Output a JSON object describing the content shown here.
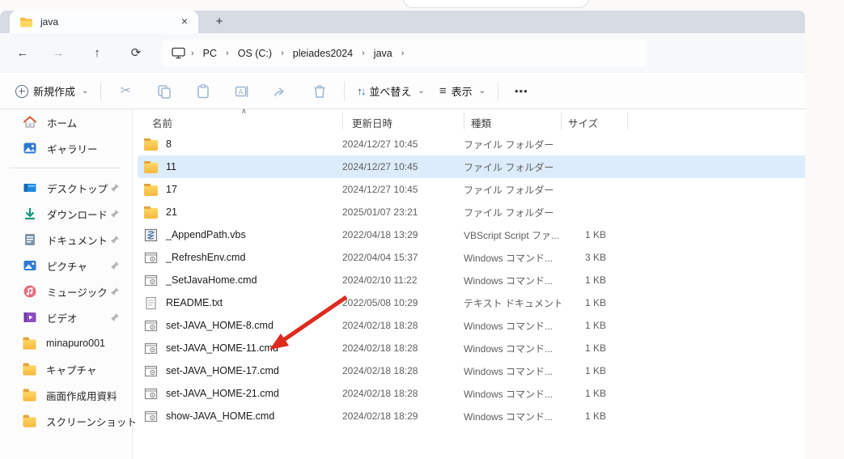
{
  "colors": {
    "tabbar_bg": "#d6dbe4",
    "selection_bg": "#dcecfa",
    "arrow_red": "#df2a1e",
    "folder_yellow": "#f8c94c",
    "accent_blue": "#1878d4"
  },
  "tab_bar": {
    "active_tab_label": "java",
    "close_glyph": "×",
    "new_tab_glyph": "+"
  },
  "address_bar": {
    "back_glyph": "←",
    "forward_glyph": "→",
    "up_glyph": "↑",
    "refresh_glyph": "⟳",
    "chevron_glyph": "›",
    "breadcrumb": {
      "items": [
        "PC",
        "OS (C:)",
        "pleiades2024",
        "java"
      ]
    }
  },
  "toolbar": {
    "new_button_label": "新規作成",
    "sort_button_label": "並べ替え",
    "view_button_label": "表示",
    "chevron_glyph": "⌄",
    "sort_up_glyph": "↑",
    "sort_down_glyph": "↓",
    "view_glyph": "≡",
    "cut_glyph": "✂",
    "more_glyph": "•••"
  },
  "sidebar": {
    "items": [
      {
        "label": "ホーム",
        "icon": "home",
        "pinned": false
      },
      {
        "label": "ギャラリー",
        "icon": "gallery",
        "pinned": false
      },
      {
        "label": "デスクトップ",
        "icon": "desktop",
        "pinned": true
      },
      {
        "label": "ダウンロード",
        "icon": "download",
        "pinned": true
      },
      {
        "label": "ドキュメント",
        "icon": "document",
        "pinned": true
      },
      {
        "label": "ピクチャ",
        "icon": "pictures",
        "pinned": true
      },
      {
        "label": "ミュージック",
        "icon": "music",
        "pinned": true
      },
      {
        "label": "ビデオ",
        "icon": "video",
        "pinned": true
      },
      {
        "label": "minapuro001",
        "icon": "folder",
        "pinned": false
      },
      {
        "label": "キャプチャ",
        "icon": "folder",
        "pinned": false
      },
      {
        "label": "画面作成用資料",
        "icon": "folder",
        "pinned": false
      },
      {
        "label": "スクリーンショット",
        "icon": "folder",
        "pinned": false
      }
    ]
  },
  "file_list": {
    "sort_indicator_glyph": "∧",
    "columns": {
      "name": "名前",
      "date": "更新日時",
      "type": "種類",
      "size": "サイズ"
    },
    "rows": [
      {
        "name": "8",
        "date": "2024/12/27 10:45",
        "type": "ファイル フォルダー",
        "size": ""
      },
      {
        "name": "11",
        "date": "2024/12/27 10:45",
        "type": "ファイル フォルダー",
        "size": ""
      },
      {
        "name": "17",
        "date": "2024/12/27 10:45",
        "type": "ファイル フォルダー",
        "size": ""
      },
      {
        "name": "21",
        "date": "2025/01/07 23:21",
        "type": "ファイル フォルダー",
        "size": ""
      },
      {
        "name": "_AppendPath.vbs",
        "date": "2022/04/18 13:29",
        "type": "VBScript Script ファ...",
        "size": "1 KB"
      },
      {
        "name": "_RefreshEnv.cmd",
        "date": "2022/04/04 15:37",
        "type": "Windows コマンド...",
        "size": "3 KB"
      },
      {
        "name": "_SetJavaHome.cmd",
        "date": "2024/02/10 11:22",
        "type": "Windows コマンド...",
        "size": "1 KB"
      },
      {
        "name": "README.txt",
        "date": "2022/05/08 10:29",
        "type": "テキスト ドキュメント",
        "size": "1 KB"
      },
      {
        "name": "set-JAVA_HOME-8.cmd",
        "date": "2024/02/18 18:28",
        "type": "Windows コマンド...",
        "size": "1 KB"
      },
      {
        "name": "set-JAVA_HOME-11.cmd",
        "date": "2024/02/18 18:28",
        "type": "Windows コマンド...",
        "size": "1 KB"
      },
      {
        "name": "set-JAVA_HOME-17.cmd",
        "date": "2024/02/18 18:28",
        "type": "Windows コマンド...",
        "size": "1 KB"
      },
      {
        "name": "set-JAVA_HOME-21.cmd",
        "date": "2024/02/18 18:28",
        "type": "Windows コマンド...",
        "size": "1 KB"
      },
      {
        "name": "show-JAVA_HOME.cmd",
        "date": "2024/02/18 18:29",
        "type": "Windows コマンド...",
        "size": "1 KB"
      }
    ],
    "selected_row": "11",
    "annotation_arrow_target": "set-JAVA_HOME-11.cmd"
  }
}
